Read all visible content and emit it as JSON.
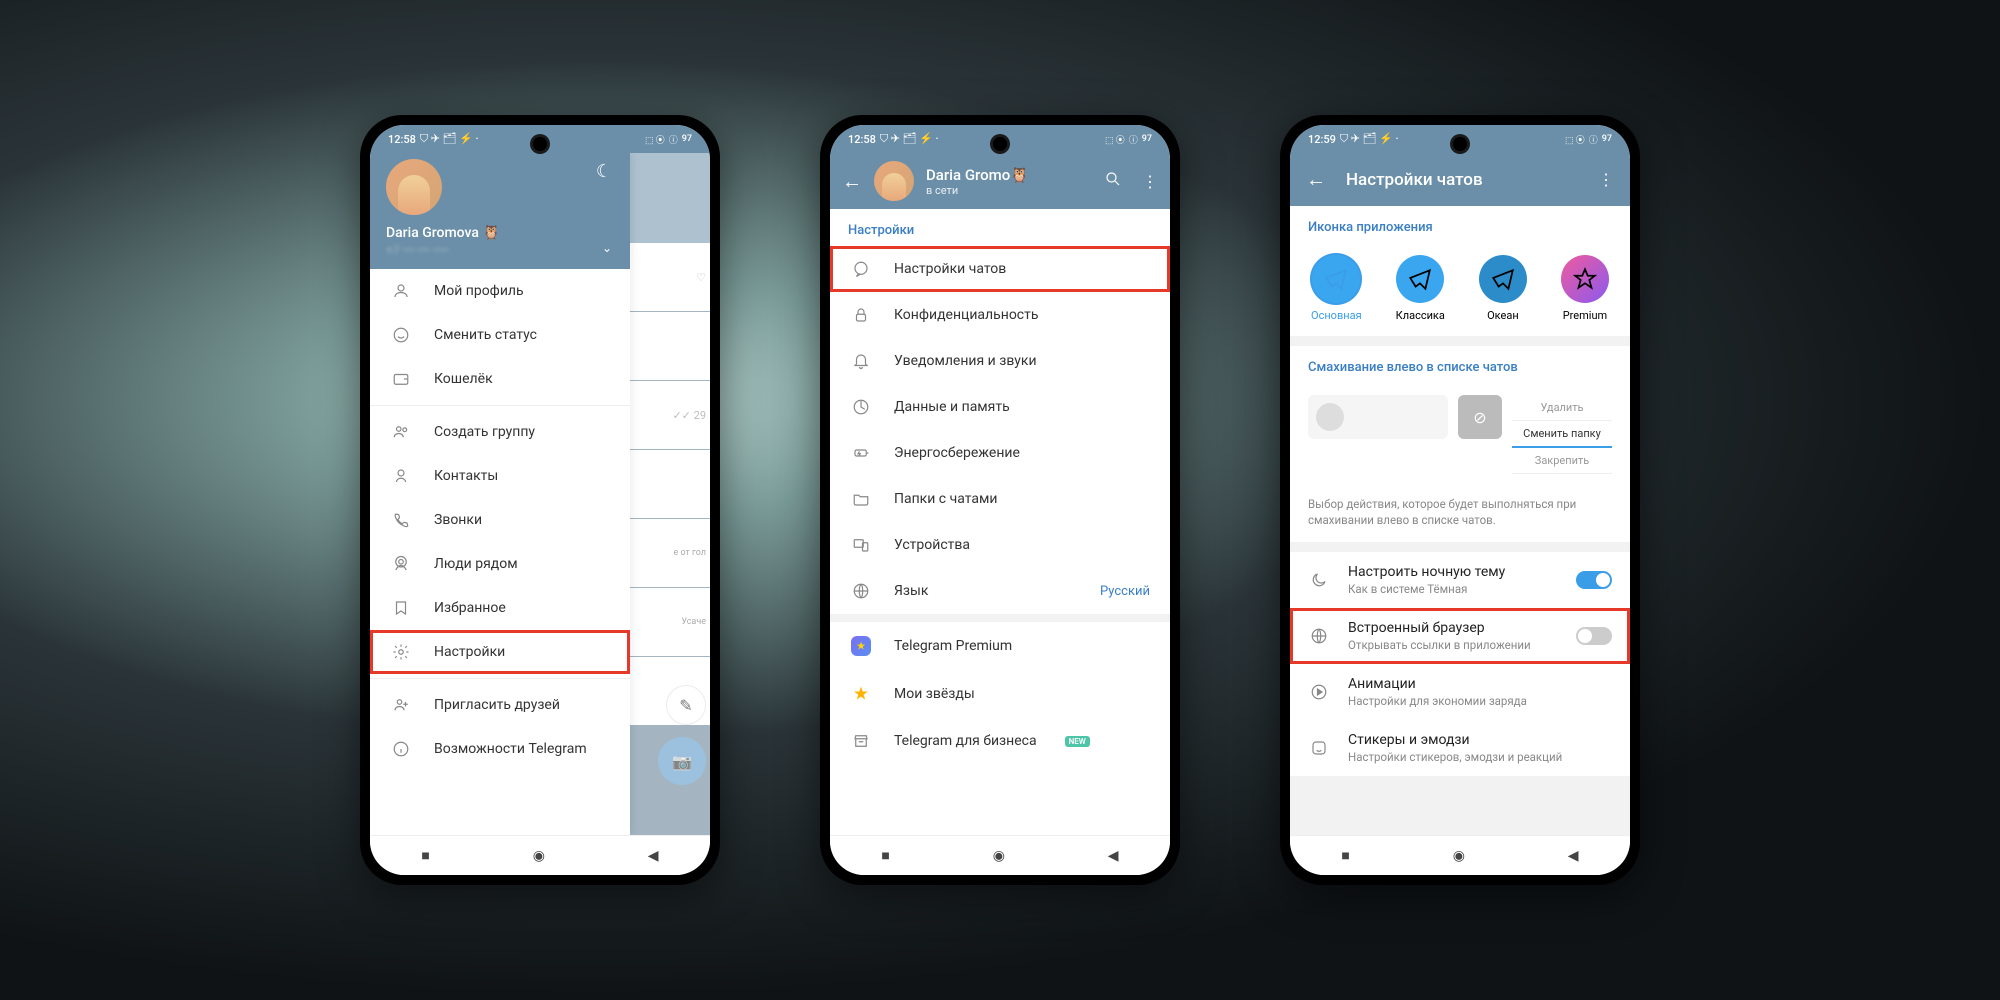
{
  "status": {
    "time1": "12:58",
    "time3": "12:59",
    "battery": "97"
  },
  "phone1": {
    "user_name": "Daria Gromova",
    "emoji": "🦉",
    "menu": [
      {
        "icon": "user",
        "label": "Мой профиль"
      },
      {
        "icon": "smile",
        "label": "Сменить статус"
      },
      {
        "icon": "wallet",
        "label": "Кошелёк"
      }
    ],
    "menu2": [
      {
        "icon": "group",
        "label": "Создать группу"
      },
      {
        "icon": "contact",
        "label": "Контакты"
      },
      {
        "icon": "phone",
        "label": "Звонки"
      },
      {
        "icon": "nearby",
        "label": "Люди рядом"
      },
      {
        "icon": "bookmark",
        "label": "Избранное"
      },
      {
        "icon": "gear",
        "label": "Настройки",
        "highlight": true
      }
    ],
    "menu3": [
      {
        "icon": "invite",
        "label": "Пригласить друзей"
      },
      {
        "icon": "info",
        "label": "Возможности Telegram"
      }
    ]
  },
  "phone2": {
    "user_name": "Daria Gromo",
    "emoji": "🦉",
    "status": "в сети",
    "section": "Настройки",
    "items": [
      {
        "icon": "chat",
        "label": "Настройки чатов",
        "highlight": true
      },
      {
        "icon": "lock",
        "label": "Конфиденциальность"
      },
      {
        "icon": "bell",
        "label": "Уведомления и звуки"
      },
      {
        "icon": "data",
        "label": "Данные и память"
      },
      {
        "icon": "battery",
        "label": "Энергосбережение"
      },
      {
        "icon": "folder",
        "label": "Папки с чатами"
      },
      {
        "icon": "devices",
        "label": "Устройства"
      },
      {
        "icon": "globe",
        "label": "Язык",
        "right": "Русский"
      }
    ],
    "items2": [
      {
        "icon": "star",
        "label": "Telegram Premium"
      },
      {
        "icon": "ystar",
        "label": "Мои звёзды"
      },
      {
        "icon": "biz",
        "label": "Telegram для бизнеса",
        "badge": "NEW"
      }
    ]
  },
  "phone3": {
    "title": "Настройки чатов",
    "section_icon": "Иконка приложения",
    "icons": [
      {
        "label": "Основная",
        "sel": true,
        "bg": "#3aa6f0"
      },
      {
        "label": "Классика",
        "bg": "#3aa6f0"
      },
      {
        "label": "Океан",
        "bg": "#3aa6f0"
      },
      {
        "label": "Premium",
        "bg": "grad"
      }
    ],
    "section_swipe": "Смахивание влево в списке чатов",
    "swipe_opts": [
      "Удалить",
      "Сменить папку",
      "Закрепить"
    ],
    "swipe_active": 1,
    "hint": "Выбор действия, которое будет выполняться при смахивании влево в списке чатов.",
    "toggles": [
      {
        "icon": "moon",
        "title": "Настроить ночную тему",
        "sub": "Как в системе Тёмная",
        "on": true
      },
      {
        "icon": "globe",
        "title": "Встроенный браузер",
        "sub": "Открывать ссылки в приложении",
        "on": false,
        "highlight": true
      },
      {
        "icon": "play",
        "title": "Анимации",
        "sub": "Настройки для экономии заряда"
      },
      {
        "icon": "sticker",
        "title": "Стикеры и эмодзи",
        "sub": "Настройки стикеров, эмодзи и реакций"
      }
    ]
  }
}
